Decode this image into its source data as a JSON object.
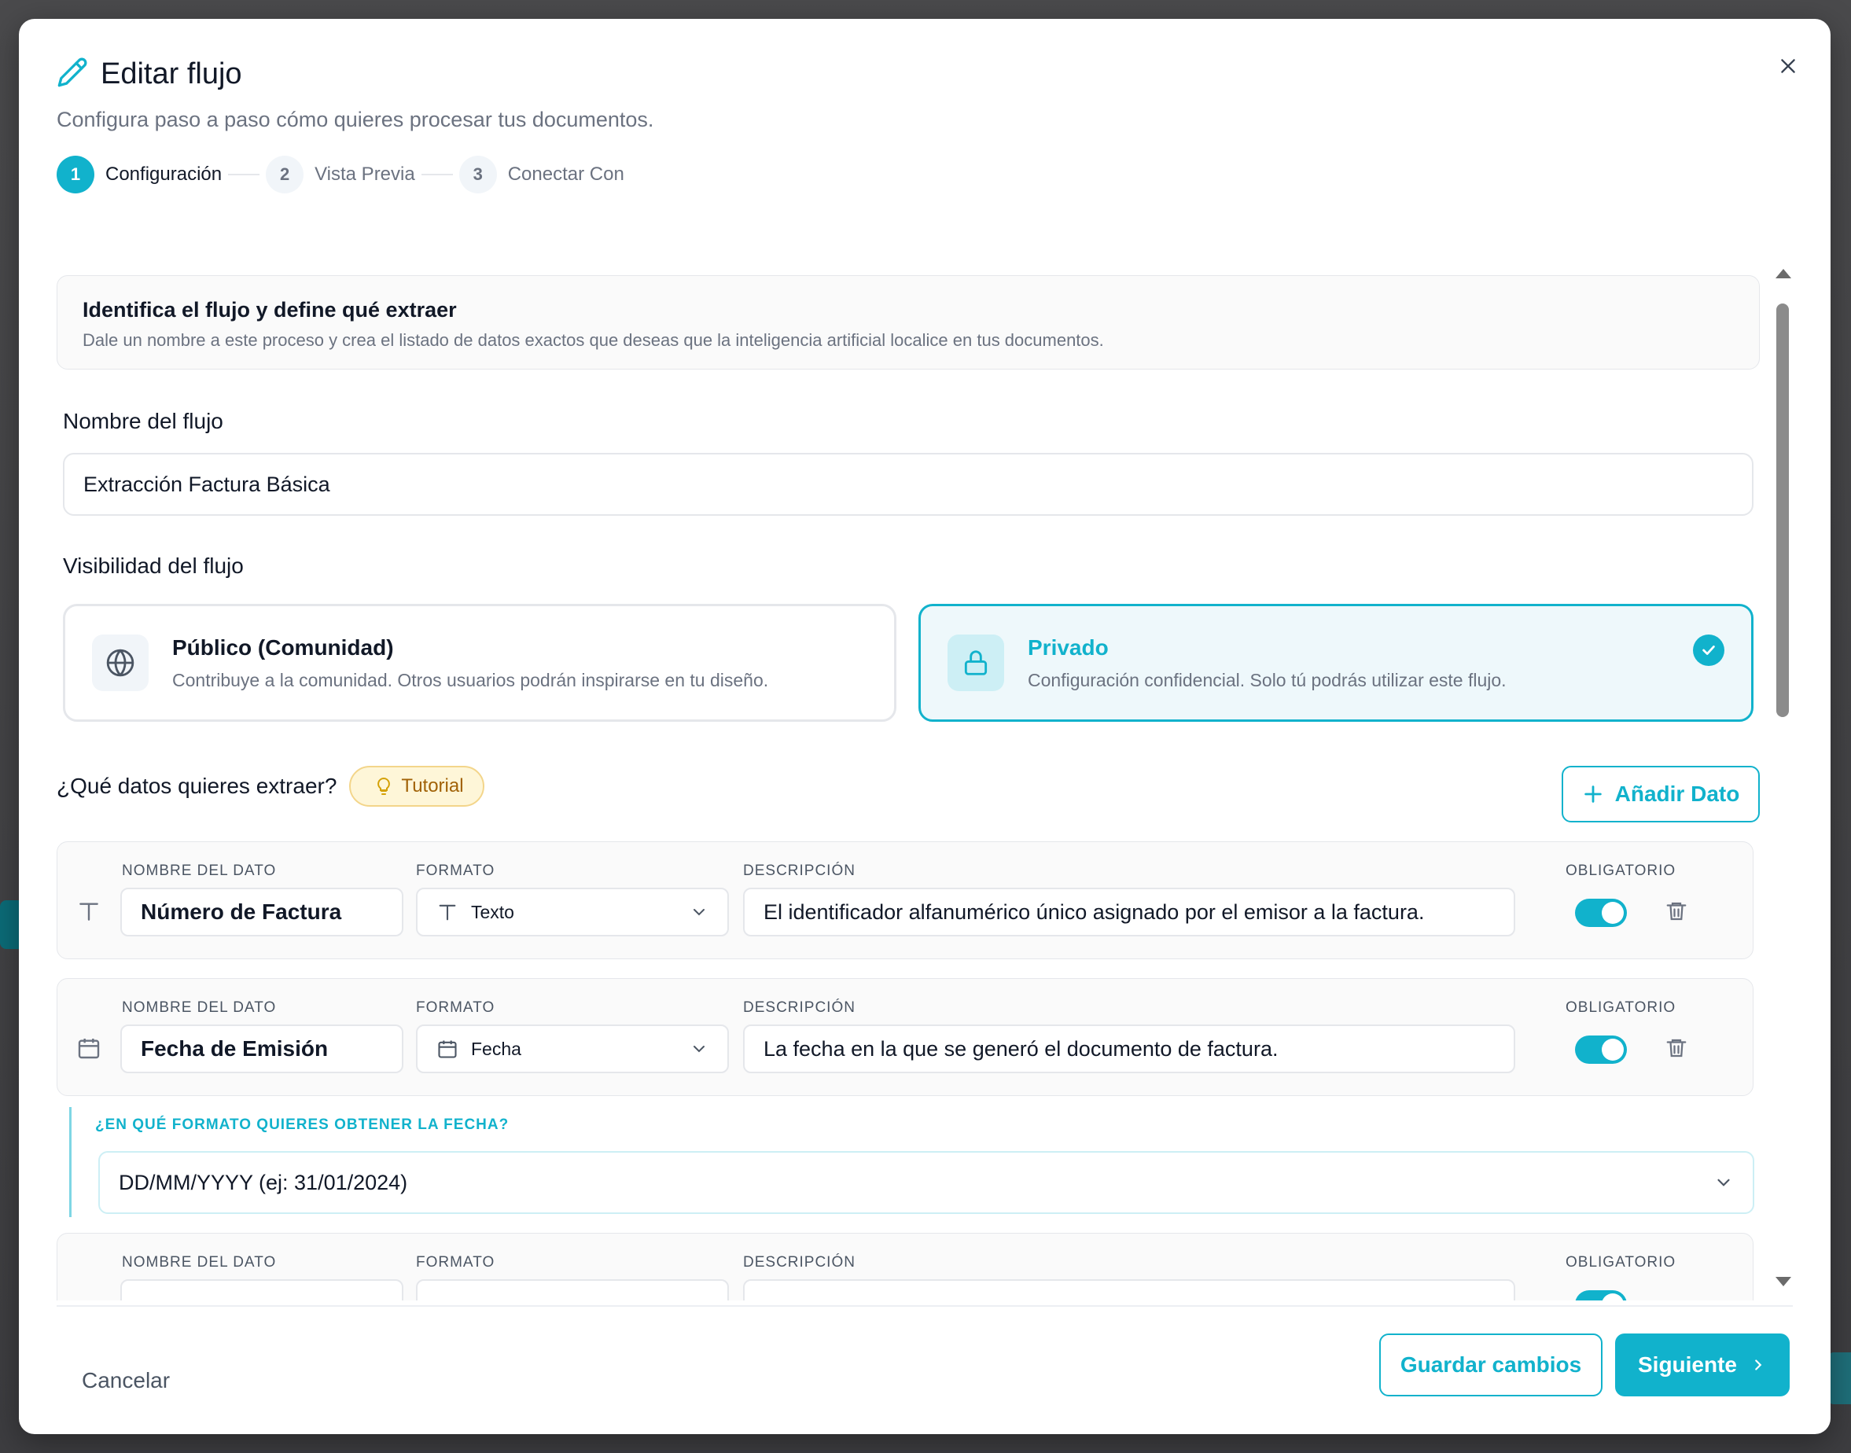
{
  "colors": {
    "accent": "#11b2cc",
    "tutorial_bg": "#fef6d8",
    "tutorial_text": "#a16207"
  },
  "header": {
    "title": "Editar flujo",
    "subtitle": "Configura paso a paso cómo quieres procesar tus documentos.",
    "title_icon": "pencil-icon",
    "close_icon": "close-icon"
  },
  "stepper": [
    {
      "num": "1",
      "label": "Configuración",
      "active": true
    },
    {
      "num": "2",
      "label": "Vista Previa",
      "active": false
    },
    {
      "num": "3",
      "label": "Conectar Con",
      "active": false
    }
  ],
  "info": {
    "title": "Identifica el flujo y define qué extraer",
    "desc": "Dale un nombre a este proceso y crea el listado de datos exactos que deseas que la inteligencia artificial localice en tus documentos."
  },
  "name_field": {
    "label": "Nombre del flujo",
    "value": "Extracción Factura Básica"
  },
  "visibility": {
    "label": "Visibilidad del flujo",
    "options": [
      {
        "title": "Público (Comunidad)",
        "desc": "Contribuye a la comunidad. Otros usuarios podrán inspirarse en tu diseño.",
        "icon": "globe-icon",
        "selected": false
      },
      {
        "title": "Privado",
        "desc": "Configuración confidencial. Solo tú podrás utilizar este flujo.",
        "icon": "lock-icon",
        "selected": true
      }
    ]
  },
  "extract": {
    "question": "¿Qué datos quieres extraer?",
    "tutorial": "Tutorial",
    "add_button": "Añadir Dato",
    "headers": {
      "name": "NOMBRE DEL DATO",
      "format": "FORMATO",
      "desc": "DESCRIPCIÓN",
      "required": "OBLIGATORIO"
    },
    "fields": [
      {
        "name": "Número de Factura",
        "format": "Texto",
        "format_icon": "text-icon",
        "desc": "El identificador alfanumérico único asignado por el emisor a la factura.",
        "required": true
      },
      {
        "name": "Fecha de Emisión",
        "format": "Fecha",
        "format_icon": "calendar-icon",
        "desc": "La fecha en la que se generó el documento de factura.",
        "required": true
      }
    ],
    "date_format": {
      "label": "¿EN QUÉ FORMATO QUIERES OBTENER LA FECHA?",
      "value": "DD/MM/YYYY (ej: 31/01/2024)"
    }
  },
  "footer": {
    "cancel": "Cancelar",
    "save": "Guardar cambios",
    "next": "Siguiente"
  }
}
